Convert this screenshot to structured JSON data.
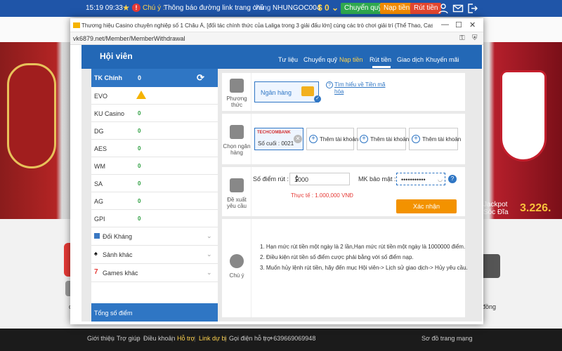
{
  "topbar": {
    "time": "15:19 09:33",
    "notice_label": "Chú ý :",
    "notice_text": "Thông báo đường link trang chủ",
    "gold_label": "Vàng",
    "username": "NHUNGOC004",
    "balance": "$ 0",
    "balance_arrow": "⌄",
    "transfer_label": "Chuyển quỹ",
    "deposit_label": "Nạp tiền",
    "withdraw_label": "Rút tiền"
  },
  "popup": {
    "window_title": "Thương hiệu Casino chuyên nghiệp số 1 Châu Á, [đối tác chính thức của Laliga trong 3 giải đấu lớn] cùng các trò chơi giải trí (Thể Thao, Casino, E-Sports,...",
    "url": "vk6879.net/Member/MemberWithdrawal"
  },
  "member": {
    "title": "Hội viên",
    "nav": [
      {
        "label": "Tư liệu",
        "active": false
      },
      {
        "label": "Chuyển quỹ",
        "active": false
      },
      {
        "label": "Nạp tiền",
        "active": true
      },
      {
        "label": "Rút tiền",
        "active": false
      },
      {
        "label": "Giao dịch",
        "active": false
      },
      {
        "label": "Khuyến mãi",
        "active": false
      }
    ]
  },
  "wallets": {
    "main_label": "TK Chính",
    "main_value": "0",
    "items": [
      {
        "name": "EVO",
        "value": ""
      },
      {
        "name": "KU Casino",
        "value": "0"
      },
      {
        "name": "DG",
        "value": "0"
      },
      {
        "name": "AES",
        "value": "0"
      },
      {
        "name": "WM",
        "value": "0"
      },
      {
        "name": "SA",
        "value": "0"
      },
      {
        "name": "AG",
        "value": "0"
      },
      {
        "name": "GPI",
        "value": "0"
      }
    ],
    "groups": [
      {
        "label": "Đối Kháng"
      },
      {
        "label": "Sảnh khác"
      },
      {
        "label": "Games khác"
      }
    ],
    "total_label": "Tổng số điểm"
  },
  "withdraw": {
    "method_section": "Phương thức",
    "method_option": "Ngân hàng",
    "method_link": "Tìm hiểu về Tiền mã hóa",
    "bank_section": "Chọn ngân hàng",
    "selected_bank": "TECHCOMBANK",
    "selected_bank_last": "Số cuối : 0021",
    "add_account_label": "Thêm tài khoản",
    "request_section": "Đề xuất yêu cầu",
    "points_label": "Số điểm rút :",
    "points_value": "1000",
    "password_label": "MK bảo mật :",
    "password_value": "•••••••••••",
    "actual_label": "Thực tế : 1.000,000 VNĐ",
    "confirm_label": "Xác nhận",
    "note_section": "Chú ý",
    "notes": [
      "1.  Hạn mức rút tiền một ngày là 2 lần,Hạn mức rút tiền một ngày là 1000000 điểm.",
      "2.  Điều kiện rút tiền số điểm cược phải bằng với số điểm nạp.",
      "3.  Muốn hủy lệnh rút tiền, hãy đến mục Hội viên-> Lịch sử giao dịch-> Hủy yêu cầu."
    ]
  },
  "background": {
    "jackpot_label": "Jackpot\nSóc Đĩa",
    "jackpot_value": "3.226.",
    "side_label_left": "c",
    "side_label_right": "đồng"
  },
  "footer": {
    "links": [
      "Giới thiệu",
      "Trợ giúp",
      "Điều khoản",
      "Hỗ trợ",
      "Link dự bị",
      "Gọi điện hỗ trợ",
      "+639669069948",
      "Sơ đồ trang mạng"
    ]
  },
  "colors": {
    "header_blue": "#2368b6",
    "accent_orange": "#f39200",
    "success_green": "#2a9d3d",
    "warning_red": "#e53935"
  }
}
